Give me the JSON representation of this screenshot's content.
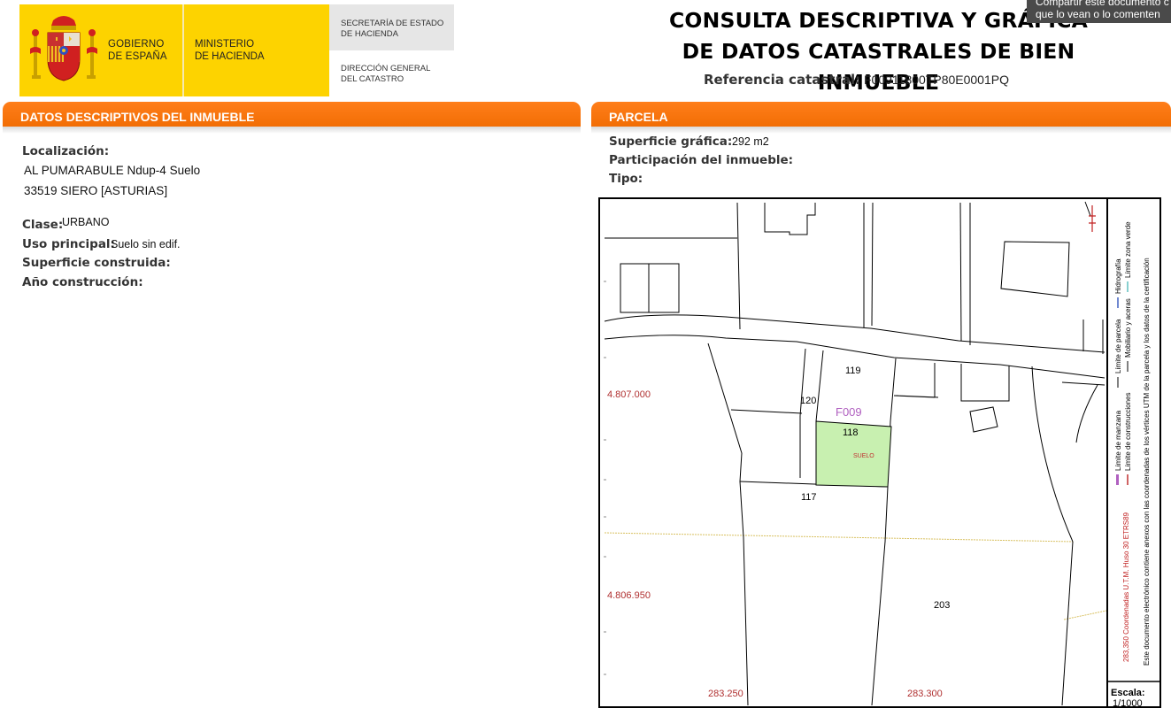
{
  "header": {
    "gobierno": [
      "GOBIERNO",
      "DE ESPAÑA"
    ],
    "ministerio": [
      "MINISTERIO",
      "DE HACIENDA"
    ],
    "secretaria": [
      "SECRETARÍA DE ESTADO",
      "DE HACIENDA"
    ],
    "direccion": [
      "DIRECCIÓN GENERAL",
      "DEL CATASTRO"
    ],
    "title_line1": "CONSULTA DESCRIPTIVA Y GRÁFICA",
    "title_line2": "DE DATOS CATASTRALES DE BIEN INMUEBLE",
    "refcat_label": "Referencia catastral:",
    "refcat_value": "F00911800TP80E0001PQ"
  },
  "tooltip": {
    "line1": "Compartir este documento c",
    "line2": "que lo vean o lo comenten"
  },
  "descriptivos": {
    "heading": "DATOS DESCRIPTIVOS DEL INMUEBLE",
    "localizacion_label": "Localización:",
    "address_line1": "AL PUMARABULE Ndup-4 Suelo",
    "address_line2": "33519 SIERO [ASTURIAS]",
    "clase_label": "Clase:",
    "clase_value": "URBANO",
    "uso_label": "Uso principal:",
    "uso_value": "Suelo sin edif.",
    "superficie_construida_label": "Superficie construida:",
    "anio_label": "Año construcción:"
  },
  "parcela": {
    "heading": "PARCELA",
    "superficie_label": "Superficie gráfica:",
    "superficie_value": "292 m2",
    "participacion_label": "Participación del inmueble:",
    "tipo_label": "Tipo:"
  },
  "map": {
    "coord_y1": "4.807.000",
    "coord_y2": "4.806.950",
    "coord_x1": "283.250",
    "coord_x2": "283.300",
    "parcel_code": "F009",
    "parcel_119": "119",
    "parcel_120": "120",
    "parcel_118": "118",
    "parcel_117": "117",
    "parcel_203": "203",
    "suelo": "SUELO",
    "escala_label": "Escala:",
    "escala_value": "1/1000",
    "legend": {
      "manzana": "Límite de manzana",
      "parcela": "Límite de parcela",
      "hidrografia": "Hidrografía",
      "construcciones": "Límite de construcciones",
      "mobiliario": "Mobiliario y aceras",
      "zona_verde": "Límite zona verde",
      "coordenadas": "283,350 Coordenadas U.T.M. Huso 30 ETRS89",
      "documento": "Este documento electrónico contiene anexos con las coordenadas de los vértices UTM de la parcela y los datos de la certificación"
    },
    "colors": {
      "parcel_fill": "#c8f0b0",
      "coord_text": "#b03030",
      "parcel_code": "#b060c0",
      "accent_bar": "#f47314"
    }
  }
}
